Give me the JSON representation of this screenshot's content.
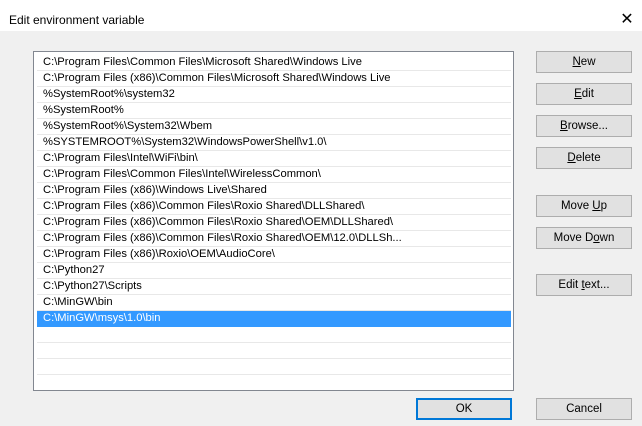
{
  "window": {
    "title": "Edit environment variable",
    "close_glyph": "✕",
    "close_icon": "close-icon"
  },
  "paths": [
    "C:\\Program Files\\Common Files\\Microsoft Shared\\Windows Live",
    "C:\\Program Files (x86)\\Common Files\\Microsoft Shared\\Windows Live",
    "%SystemRoot%\\system32",
    "%SystemRoot%",
    "%SystemRoot%\\System32\\Wbem",
    "%SYSTEMROOT%\\System32\\WindowsPowerShell\\v1.0\\",
    "C:\\Program Files\\Intel\\WiFi\\bin\\",
    "C:\\Program Files\\Common Files\\Intel\\WirelessCommon\\",
    "C:\\Program Files (x86)\\Windows Live\\Shared",
    "C:\\Program Files (x86)\\Common Files\\Roxio Shared\\DLLShared\\",
    "C:\\Program Files (x86)\\Common Files\\Roxio Shared\\OEM\\DLLShared\\",
    "C:\\Program Files (x86)\\Common Files\\Roxio Shared\\OEM\\12.0\\DLLSh...",
    "C:\\Program Files (x86)\\Roxio\\OEM\\AudioCore\\",
    "C:\\Python27",
    "C:\\Python27\\Scripts",
    "C:\\MinGW\\bin",
    "C:\\MinGW\\msys\\1.0\\bin"
  ],
  "selected_index": 16,
  "buttons": {
    "new": {
      "pre": "",
      "accel": "N",
      "post": "ew"
    },
    "edit": {
      "pre": "",
      "accel": "E",
      "post": "dit"
    },
    "browse": {
      "pre": "",
      "accel": "B",
      "post": "rowse..."
    },
    "delete": {
      "pre": "",
      "accel": "D",
      "post": "elete"
    },
    "move_up": {
      "pre": "Move ",
      "accel": "U",
      "post": "p"
    },
    "move_down": {
      "pre": "Move D",
      "accel": "o",
      "post": "wn"
    },
    "edit_text": {
      "pre": "Edit ",
      "accel": "t",
      "post": "ext..."
    },
    "ok": "OK",
    "cancel": "Cancel"
  },
  "colors": {
    "selection": "#3399ff",
    "dialog_bg": "#f0f0f0",
    "default_button_border": "#0078d7"
  }
}
